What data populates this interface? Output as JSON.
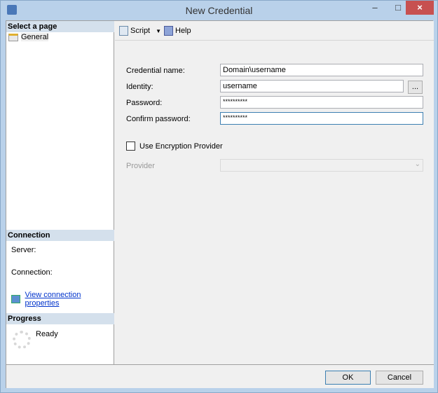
{
  "window": {
    "title": "New Credential",
    "minimize": "–",
    "maximize": "□",
    "close": "×"
  },
  "sidebar": {
    "select_page": "Select a page",
    "pages": [
      {
        "label": "General"
      }
    ],
    "connection": {
      "header": "Connection",
      "server_label": "Server:",
      "connection_label": "Connection:",
      "view_props": "View connection properties"
    },
    "progress": {
      "header": "Progress",
      "status": "Ready"
    }
  },
  "toolbar": {
    "script": "Script",
    "help": "Help"
  },
  "form": {
    "credential_name_label": "Credential name:",
    "credential_name": "Domain\\username",
    "identity_label": "Identity:",
    "identity": "username",
    "browse": "...",
    "password_label": "Password:",
    "password": "**********",
    "confirm_label": "Confirm password:",
    "confirm": "**********",
    "encryption_label": "Use Encryption Provider",
    "encryption_checked": false,
    "provider_label": "Provider",
    "provider": ""
  },
  "buttons": {
    "ok": "OK",
    "cancel": "Cancel"
  }
}
